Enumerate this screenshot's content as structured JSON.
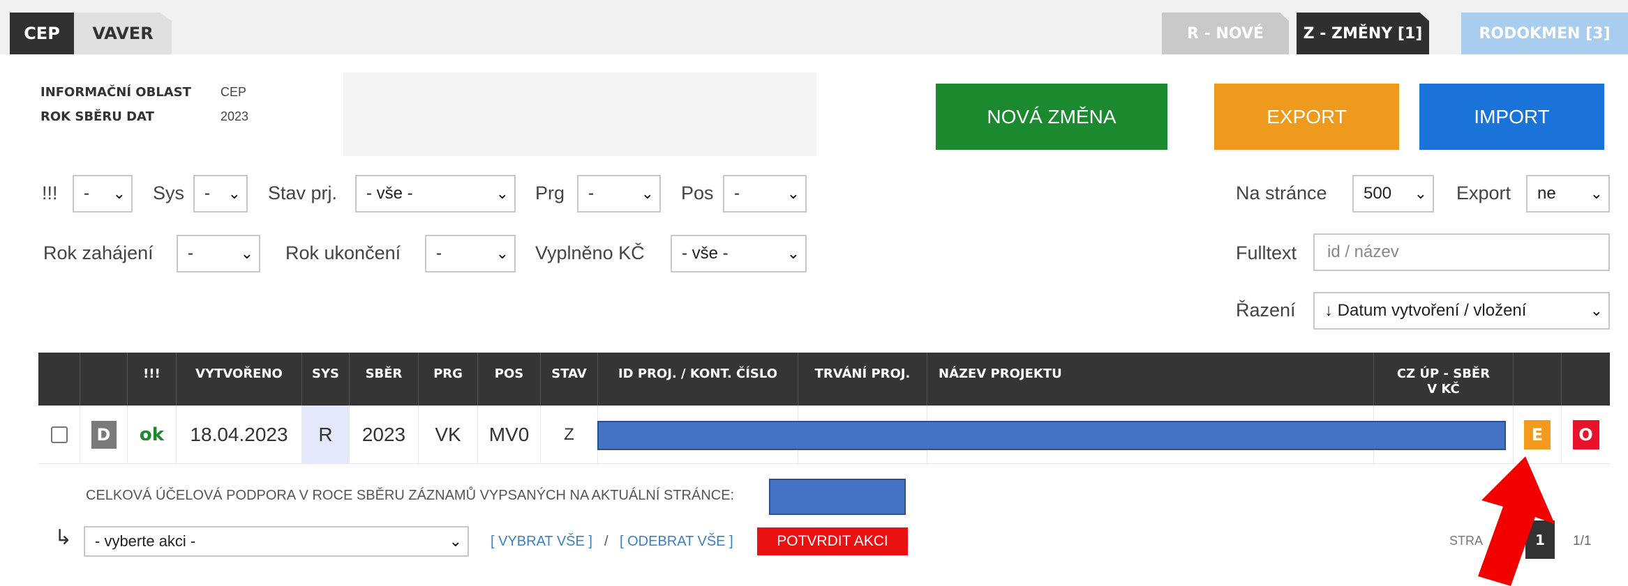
{
  "tabs": {
    "left": [
      "CEP",
      "VAVER"
    ],
    "right": {
      "r_nove": "R - NOVÉ",
      "z_zmeny": "Z - ZMĚNY [1]",
      "rodokmen": "RODOKMEN [3]"
    }
  },
  "info": {
    "oblast_label": "INFORMAČNÍ OBLAST",
    "oblast_value": "CEP",
    "rok_label": "ROK SBĚRU DAT",
    "rok_value": "2023"
  },
  "actions": {
    "nova_zmena": "NOVÁ ZMĚNA",
    "export": "EXPORT",
    "import": "IMPORT"
  },
  "filters": {
    "excl_label": "!!!",
    "excl_value": "-",
    "sys_label": "Sys",
    "sys_value": "-",
    "stav_label": "Stav prj.",
    "stav_value": "- vše -",
    "prg_label": "Prg",
    "prg_value": "-",
    "pos_label": "Pos",
    "pos_value": "-",
    "rok_zahajeni_label": "Rok zahájení",
    "rok_zahajeni_value": "-",
    "rok_ukonceni_label": "Rok ukončení",
    "rok_ukonceni_value": "-",
    "vyplneno_label": "Vyplněno KČ",
    "vyplneno_value": "- vše -",
    "na_strance_label": "Na stránce",
    "na_strance_value": "500",
    "export_label": "Export",
    "export_value": "ne",
    "fulltext_label": "Fulltext",
    "fulltext_placeholder": "id / název",
    "razeni_label": "Řazení",
    "razeni_value": "↓ Datum vytvoření / vložení"
  },
  "table": {
    "headers": [
      "!!!",
      "VYTVOŘENO",
      "SYS",
      "SBĚR",
      "PRG",
      "POS",
      "STAV",
      "ID PROJ. / KONT. ČÍSLO",
      "TRVÁNÍ PROJ.",
      "NÁZEV PROJEKTU",
      "CZ ÚP - SBĚR V KČ"
    ],
    "rows": [
      {
        "d_badge": "D",
        "excl": "ok",
        "vytvoreno": "18.04.2023",
        "sys": "R",
        "sber": "2023",
        "prg": "VK",
        "pos": "MV0",
        "stav": "Z",
        "e_badge": "E",
        "o_badge": "O"
      }
    ]
  },
  "footer": {
    "total_label": "CELKOVÁ ÚČELOVÁ PODPORA V ROCE SBĚRU ZÁZNAMŮ VYPSANÝCH NA AKTUÁLNÍ STRÁNCE:",
    "action_select": "- vyberte akci -",
    "vybrat_vse": "[ VYBRAT VŠE ]",
    "slash": "/",
    "odebrat_vse": "[ ODEBRAT VŠE ]",
    "potvrdit": "POTVRDIT AKCI",
    "strana_label": "STRA",
    "page_current": "1",
    "page_total": "1/1"
  },
  "colors": {
    "green": "#1b8a2e",
    "orange": "#ee9a1c",
    "blue": "#1a73d9",
    "red": "#ec1111",
    "header_dark": "#353535",
    "redaction_blue": "#4472c4",
    "arrow_red": "#f00000"
  },
  "icons": {
    "return_arrow": "↳",
    "chevron": "chevron-down-icon"
  }
}
